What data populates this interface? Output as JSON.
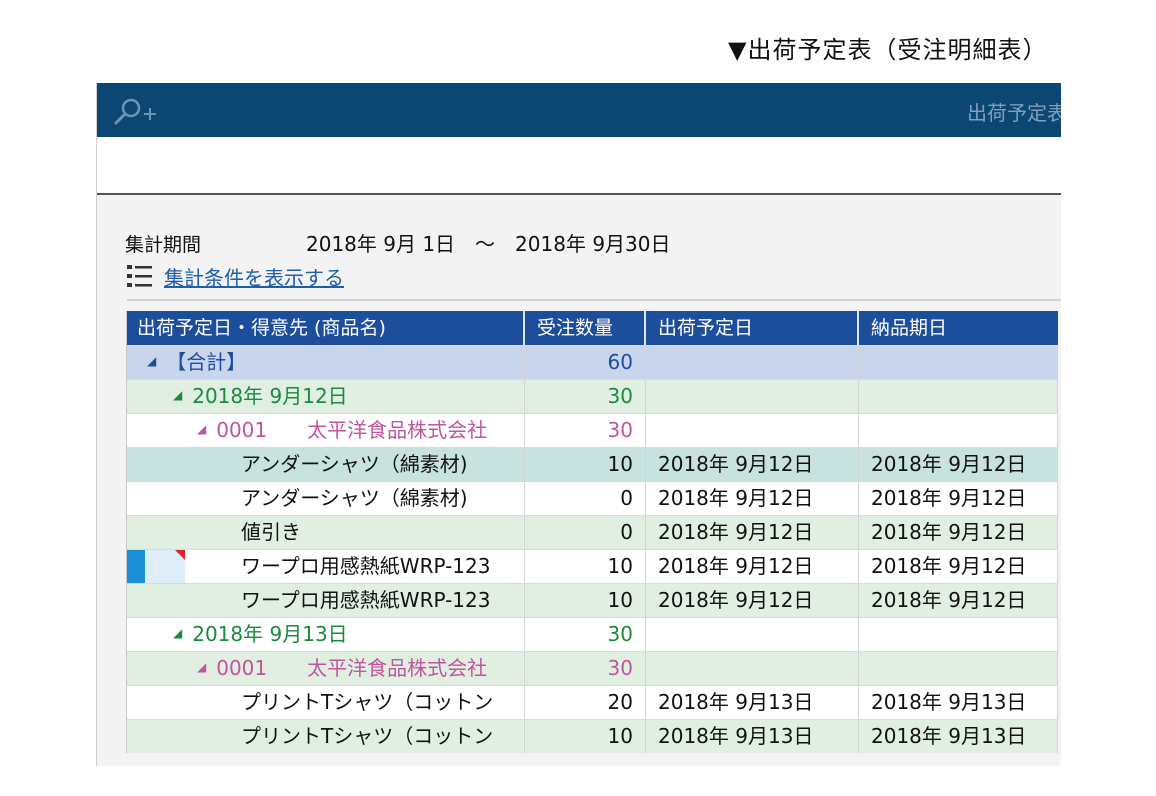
{
  "caption": "▼出荷予定表（受注明細表）",
  "topbar": {
    "title": "出荷予定表"
  },
  "period": {
    "label": "集計期間",
    "value": "2018年 9月 1日　～　2018年 9月30日"
  },
  "conditions_link": "集計条件を表示する",
  "columns": [
    "出荷予定日・得意先 (商品名)",
    "受注数量",
    "出荷予定日",
    "納品期日"
  ],
  "rows": [
    {
      "kind": "total",
      "label": "【合計】",
      "qty": "60",
      "ship": "",
      "due": ""
    },
    {
      "kind": "date",
      "label": "2018年  9月12日",
      "qty": "30",
      "ship": "",
      "due": ""
    },
    {
      "kind": "customer",
      "label": "0001　　太平洋食品株式会社",
      "qty": "30",
      "ship": "",
      "due": ""
    },
    {
      "kind": "item",
      "label": "アンダーシャツ（綿素材)",
      "qty": "10",
      "ship": "2018年 9月12日",
      "due": "2018年 9月12日"
    },
    {
      "kind": "item",
      "label": "アンダーシャツ（綿素材)",
      "qty": "0",
      "ship": "2018年 9月12日",
      "due": "2018年 9月12日"
    },
    {
      "kind": "item",
      "label": "値引き",
      "qty": "0",
      "ship": "2018年 9月12日",
      "due": "2018年 9月12日"
    },
    {
      "kind": "item",
      "label": "ワープロ用感熱紙WRP-123",
      "qty": "10",
      "ship": "2018年 9月12日",
      "due": "2018年 9月12日"
    },
    {
      "kind": "item",
      "label": "ワープロ用感熱紙WRP-123",
      "qty": "10",
      "ship": "2018年 9月12日",
      "due": "2018年 9月12日"
    },
    {
      "kind": "date",
      "label": "2018年  9月13日",
      "qty": "30",
      "ship": "",
      "due": ""
    },
    {
      "kind": "customer",
      "label": "0001　　太平洋食品株式会社",
      "qty": "30",
      "ship": "",
      "due": ""
    },
    {
      "kind": "item",
      "label": "プリントTシャツ（コットン",
      "qty": "20",
      "ship": "2018年 9月13日",
      "due": "2018年 9月13日"
    },
    {
      "kind": "item",
      "label": "プリントTシャツ（コットン",
      "qty": "10",
      "ship": "2018年 9月13日",
      "due": "2018年 9月13日"
    }
  ],
  "colors": {
    "topbar": "#0c4672",
    "header": "#1d4e9c",
    "total_row": "#c9d5ec",
    "green_row": "#e1efe3",
    "highlight_row": "#c7e2df",
    "date_text": "#1a8a3c",
    "customer_text": "#c0569c",
    "link": "#1e5fa8"
  },
  "icons": {
    "search": "search-plus-icon",
    "list": "list-icon",
    "expand": "triangle-down-icon"
  }
}
